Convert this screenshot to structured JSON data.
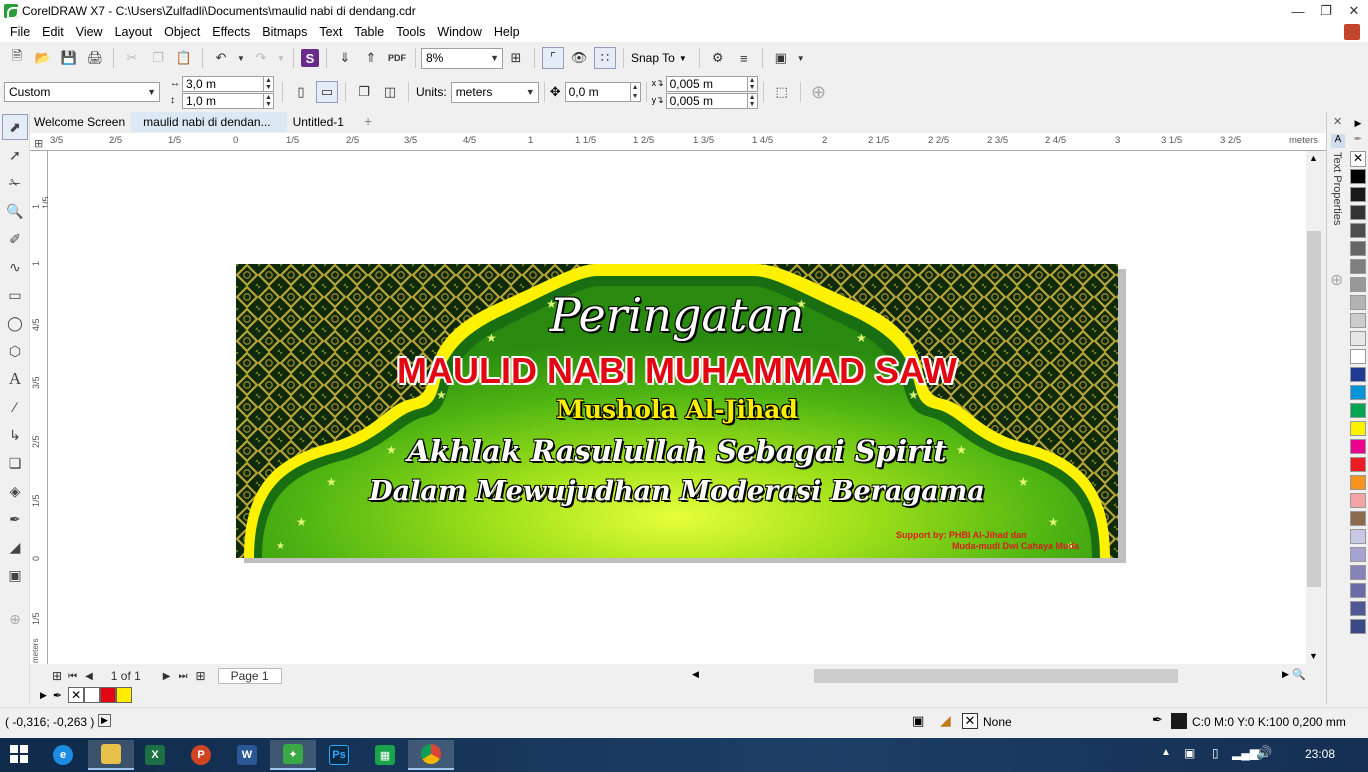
{
  "window": {
    "title": "CorelDRAW X7 - C:\\Users\\Zulfadli\\Documents\\maulid nabi di dendang.cdr"
  },
  "menu": [
    {
      "label": "File"
    },
    {
      "label": "Edit"
    },
    {
      "label": "View"
    },
    {
      "label": "Layout"
    },
    {
      "label": "Object"
    },
    {
      "label": "Effects"
    },
    {
      "label": "Bitmaps"
    },
    {
      "label": "Text"
    },
    {
      "label": "Table"
    },
    {
      "label": "Tools"
    },
    {
      "label": "Window"
    },
    {
      "label": "Help"
    }
  ],
  "toolbar": {
    "zoom": "8%",
    "snap_to": "Snap To"
  },
  "property_bar": {
    "preset": "Custom",
    "width": "3,0 m",
    "height": "1,0 m",
    "units_label": "Units:",
    "units": "meters",
    "nudge": "0,0 m",
    "dup_x": "0,005 m",
    "dup_y": "0,005 m"
  },
  "tabs": [
    {
      "label": "Welcome Screen"
    },
    {
      "label": "maulid nabi di dendan..."
    },
    {
      "label": "Untitled-1"
    }
  ],
  "ruler": {
    "unit": "meters",
    "h_ticks": [
      "3/5",
      "2/5",
      "1/5",
      "0",
      "1/5",
      "2/5",
      "3/5",
      "4/5",
      "1",
      "1 1/5",
      "1 2/5",
      "1 3/5",
      "1 4/5",
      "2",
      "2 1/5",
      "2 2/5",
      "2 3/5",
      "2 4/5",
      "3",
      "3 1/5",
      "3 2/5"
    ],
    "v_ticks": [
      "1 1/5",
      "1",
      "4/5",
      "3/5",
      "2/5",
      "1/5",
      "0",
      "1/5"
    ],
    "v_unit": "meters"
  },
  "banner": {
    "line1": "Peringatan",
    "line2": "MAULID NABI MUHAMMAD SAW",
    "line3": "Mushola Al-Jihad",
    "line4": "Akhlak Rasulullah Sebagai Spirit",
    "line5": "Dalam Mewujudhan Moderasi Beragama",
    "support1": "Support by: PHBI Al-Jihad dan",
    "support2": "Muda-mudi Dwi Cahaya Muda"
  },
  "page_nav": {
    "count": "1 of 1",
    "page_tab": "Page 1"
  },
  "docker": {
    "label": "Text Properties"
  },
  "palette_colors": [
    "#000000",
    "#1a1a1a",
    "#333333",
    "#4d4d4d",
    "#666666",
    "#808080",
    "#999999",
    "#b3b3b3",
    "#cccccc",
    "#e6e6e6",
    "#ffffff",
    "#1f3a93",
    "#0095da",
    "#00a651",
    "#fff200",
    "#ec008c",
    "#ed1c24",
    "#f7941d",
    "#f4a3a8",
    "#8b6a4e",
    "#c9c9e6",
    "#a7a3d1",
    "#8683b8",
    "#6b6ba8",
    "#4f5896",
    "#3a4a86"
  ],
  "doc_palette": [
    "none",
    "#ffffff",
    "#e30613",
    "#ffed00"
  ],
  "status": {
    "coords": "( -0,316; -0,263 )",
    "fill": "None",
    "outline": "C:0 M:0 Y:0 K:100  0,200 mm"
  },
  "taskbar": {
    "clock": "23:08"
  }
}
